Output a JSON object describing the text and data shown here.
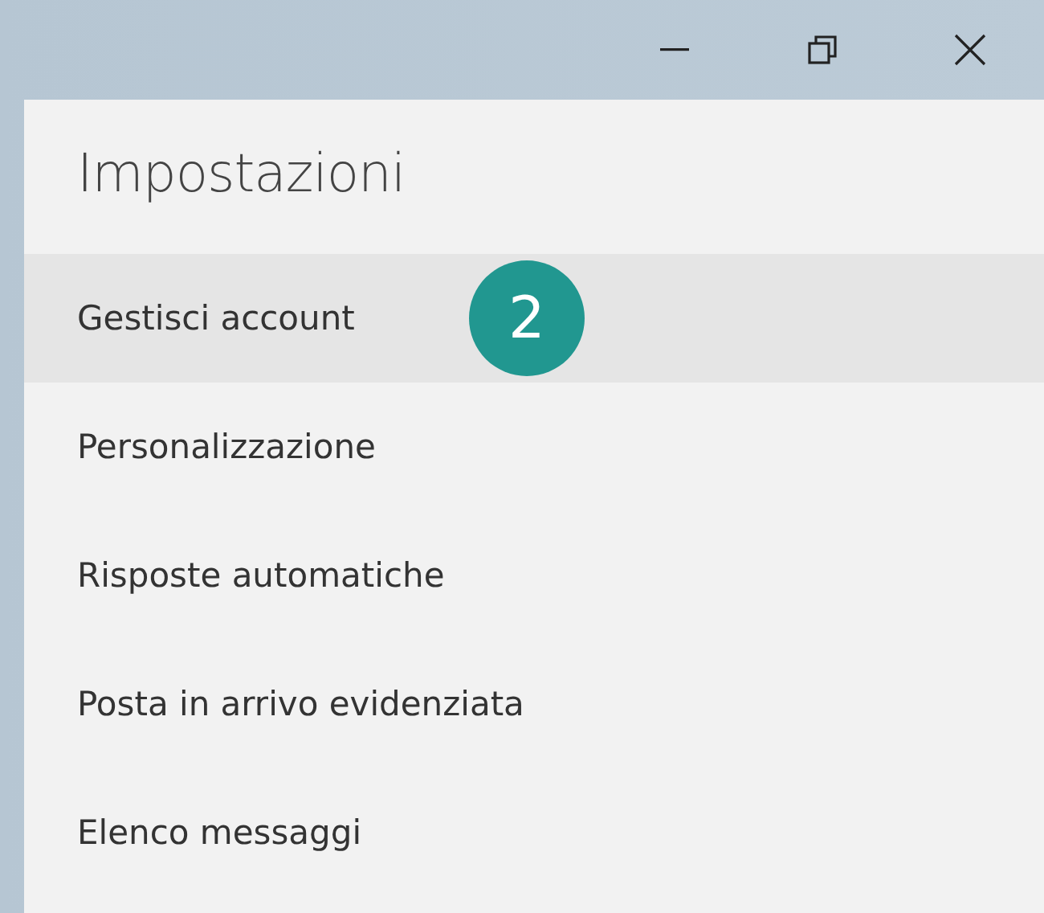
{
  "window_controls": [
    {
      "kind": "minimize"
    },
    {
      "kind": "restore"
    },
    {
      "kind": "close"
    }
  ],
  "panel": {
    "title": "Impostazioni",
    "items": [
      {
        "label": "Gestisci account",
        "selected": true
      },
      {
        "label": "Personalizzazione",
        "selected": false
      },
      {
        "label": "Risposte automatiche",
        "selected": false
      },
      {
        "label": "Posta in arrivo evidenziata",
        "selected": false
      },
      {
        "label": "Elenco messaggi",
        "selected": false
      }
    ]
  },
  "step_badge": {
    "text": "2"
  }
}
